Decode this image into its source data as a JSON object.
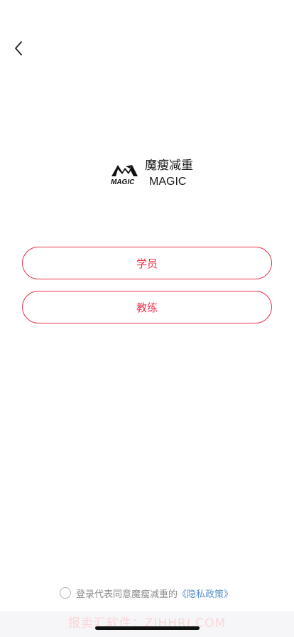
{
  "nav": {
    "back_icon": "chevron-left-icon"
  },
  "brand": {
    "logo_text": "MAGIC",
    "name_cn": "魔瘦减重",
    "name_en": "MAGIC"
  },
  "roles": {
    "student_label": "学员",
    "coach_label": "教练"
  },
  "agreement": {
    "text": "登录代表同意魔瘦减重的",
    "policy_link": "《隐私政策》",
    "checked": false
  },
  "watermark": {
    "text": "报卖汇软件：ZJHHRJ.COM"
  },
  "colors": {
    "accent": "#e8384e",
    "link": "#5a8fc8",
    "text": "#1a1a1a",
    "muted": "#8c8c8c"
  }
}
